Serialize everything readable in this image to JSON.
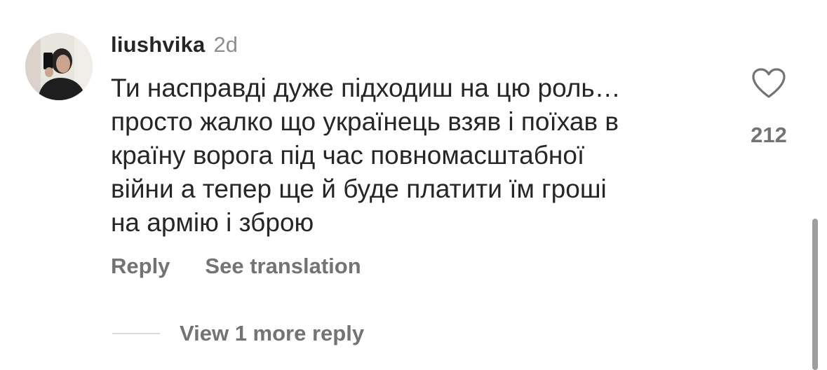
{
  "comment": {
    "username": "liushvika",
    "timestamp": "2d",
    "text_lines": [
      "Ти насправді дуже підходиш на цю роль…",
      "просто жалко що українець взяв і поїхав в",
      "країну ворога під час повномасштабної",
      "війни а тепер ще й буде платити їм гроші",
      "на армію і зброю"
    ],
    "actions": {
      "reply": "Reply",
      "see_translation": "See translation"
    },
    "view_replies": "View 1 more reply",
    "likes": {
      "count": "212",
      "icon": "heart-outline-icon"
    },
    "avatar": {
      "icon": "user-avatar-photo"
    }
  },
  "colors": {
    "text_primary": "#262626",
    "text_secondary": "#737373",
    "timestamp": "#8e8e8e",
    "divider": "#dbdbdb",
    "scrollbar": "#9e9e9e",
    "background": "#ffffff"
  }
}
